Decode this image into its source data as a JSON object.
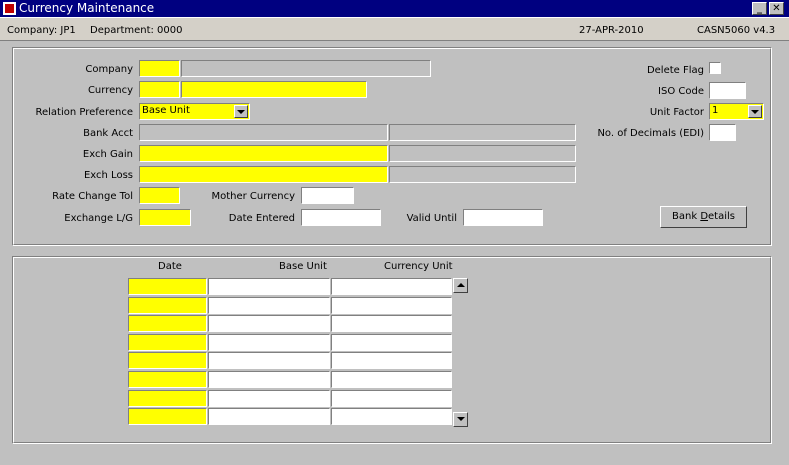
{
  "window": {
    "title": "Currency Maintenance"
  },
  "info": {
    "company": "Company:  JP1",
    "department": "Department:  0000",
    "date": "27-APR-2010",
    "program": "CASN5060  v4.3"
  },
  "form": {
    "company_label": "Company",
    "currency_label": "Currency",
    "relation_label": "Relation Preference",
    "relation_value": "Base Unit",
    "bank_acct_label": "Bank Acct",
    "exch_gain_label": "Exch Gain",
    "exch_loss_label": "Exch Loss",
    "rate_change_label": "Rate Change Tol",
    "mother_currency_label": "Mother Currency",
    "exchange_lg_label": "Exchange L/G",
    "date_entered_label": "Date Entered",
    "valid_until_label": "Valid Until",
    "delete_flag_label": "Delete Flag",
    "iso_code_label": "ISO Code",
    "unit_factor_label": "Unit Factor",
    "unit_factor_value": "1",
    "decimals_label": "No. of Decimals (EDI)",
    "bank_details_pre": "Bank ",
    "bank_details_ul": "D",
    "bank_details_post": "etails"
  },
  "grid": {
    "headers": [
      "Date",
      "Base Unit",
      "Currency Unit"
    ],
    "row_count": 8
  },
  "colors": {
    "title_bar": "#000080",
    "required_field": "#ffff00",
    "face": "#c0c0c0"
  },
  "icons": {
    "app": "app-icon",
    "minimize": "minimize-icon",
    "close": "close-icon"
  }
}
